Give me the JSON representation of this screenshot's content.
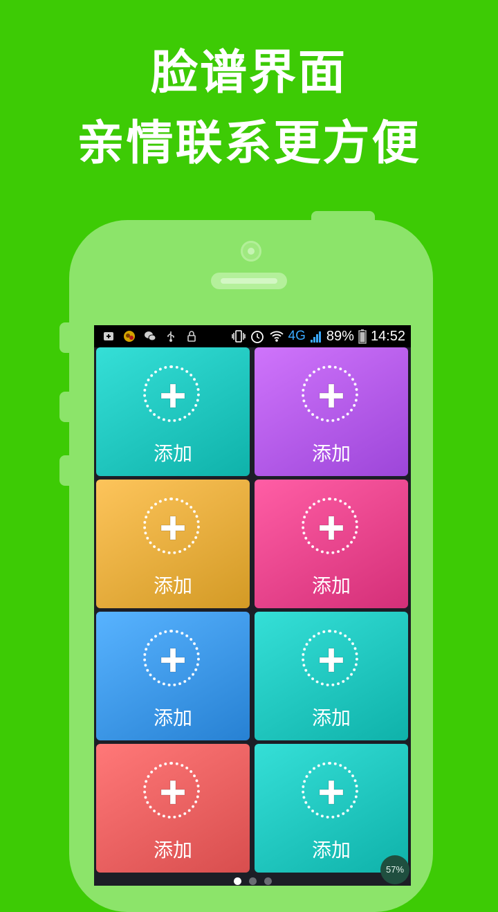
{
  "promo": {
    "headline_line1": "脸谱界面",
    "headline_line2": "亲情联系更方便"
  },
  "status_bar": {
    "left_icons": [
      "plus-square-icon",
      "app-icon",
      "wechat-icon",
      "usb-icon",
      "lock-icon"
    ],
    "right_icons": [
      "vibrate-icon",
      "alarm-icon",
      "wifi-icon",
      "signal-icon",
      "battery-icon"
    ],
    "network": "4G",
    "battery": "89%",
    "time": "14:52"
  },
  "tiles": [
    {
      "label": "添加",
      "color_from": "#35dfd7",
      "color_to": "#0fb2aa"
    },
    {
      "label": "添加",
      "color_from": "#cf74fb",
      "color_to": "#9d46d9"
    },
    {
      "label": "添加",
      "color_from": "#fdc45b",
      "color_to": "#d39a25"
    },
    {
      "label": "添加",
      "color_from": "#ff5ea5",
      "color_to": "#d42f78"
    },
    {
      "label": "添加",
      "color_from": "#58b3ff",
      "color_to": "#2781d3"
    },
    {
      "label": "添加",
      "color_from": "#35dfd7",
      "color_to": "#0fb2aa"
    },
    {
      "label": "添加",
      "color_from": "#ff7878",
      "color_to": "#d84e4e"
    },
    {
      "label": "添加",
      "color_from": "#35dfd7",
      "color_to": "#0fb2aa"
    }
  ],
  "pager": {
    "count": 3,
    "active_index": 0
  },
  "progress_badge": "57%",
  "colors": {
    "background": "#3dcb05",
    "phone": "#8ce46a"
  }
}
